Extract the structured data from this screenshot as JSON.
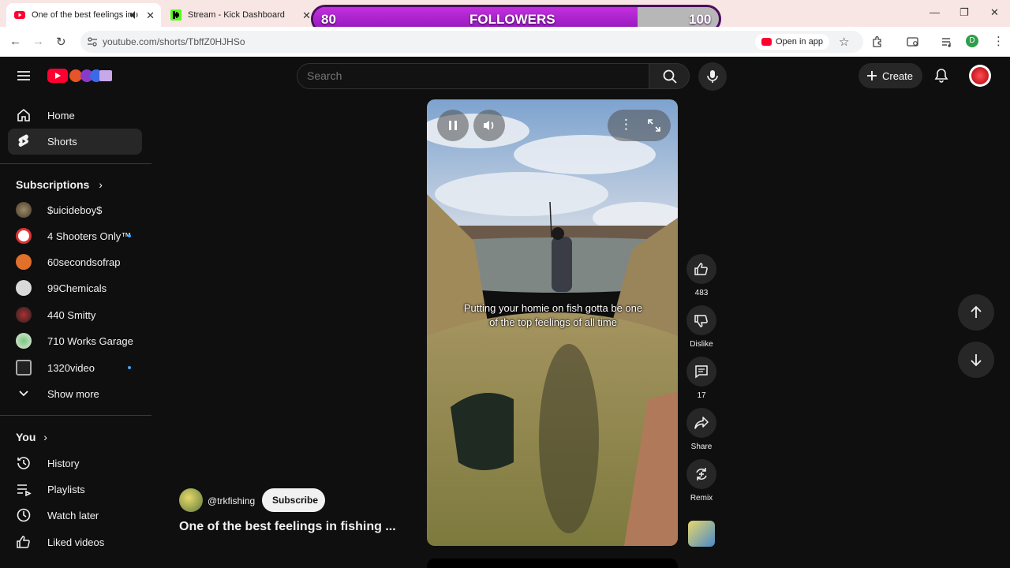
{
  "browser": {
    "tabs": [
      {
        "title": "One of the best feelings in f"
      },
      {
        "title": "Stream - Kick Dashboard"
      }
    ],
    "url": "youtube.com/shorts/TbffZ0HJHSo",
    "open_in_app": "Open in app",
    "profile_initial": "D"
  },
  "overlay": {
    "current": "80",
    "label": "FOLLOWERS",
    "goal": "100",
    "progress": 0.8
  },
  "header": {
    "search_placeholder": "Search",
    "create_label": "Create"
  },
  "sidebar": {
    "main": [
      {
        "label": "Home",
        "icon": "home-icon"
      },
      {
        "label": "Shorts",
        "icon": "shorts-icon",
        "selected": true
      }
    ],
    "subscriptions_title": "Subscriptions",
    "subscriptions": [
      {
        "label": "$uicideboy$",
        "dot": false,
        "color": "#7a6a4a"
      },
      {
        "label": "4 Shooters Only™",
        "dot": true,
        "color": "#d8d8d8"
      },
      {
        "label": "60secondsofrap",
        "dot": false,
        "color": "#e0702a"
      },
      {
        "label": "99Chemicals",
        "dot": false,
        "color": "#d9d9d9"
      },
      {
        "label": "440 Smitty",
        "dot": false,
        "color": "#333333"
      },
      {
        "label": "710 Works Garage",
        "dot": false,
        "color": "#e6e6e6"
      },
      {
        "label": "1320video",
        "dot": true,
        "color": "#222222"
      }
    ],
    "show_more": "Show more",
    "you_title": "You",
    "you": [
      {
        "label": "History",
        "icon": "history-icon"
      },
      {
        "label": "Playlists",
        "icon": "playlists-icon"
      },
      {
        "label": "Watch later",
        "icon": "watch-later-icon"
      },
      {
        "label": "Liked videos",
        "icon": "liked-videos-icon"
      }
    ]
  },
  "short": {
    "caption": "Putting your homie on fish gotta be one of the top feelings of all time",
    "channel": "@trkfishing",
    "subscribe": "Subscribe",
    "title": "One of the best feelings in fishing ..."
  },
  "actions": {
    "likes": "483",
    "dislike": "Dislike",
    "comments": "17",
    "share": "Share",
    "remix": "Remix"
  }
}
